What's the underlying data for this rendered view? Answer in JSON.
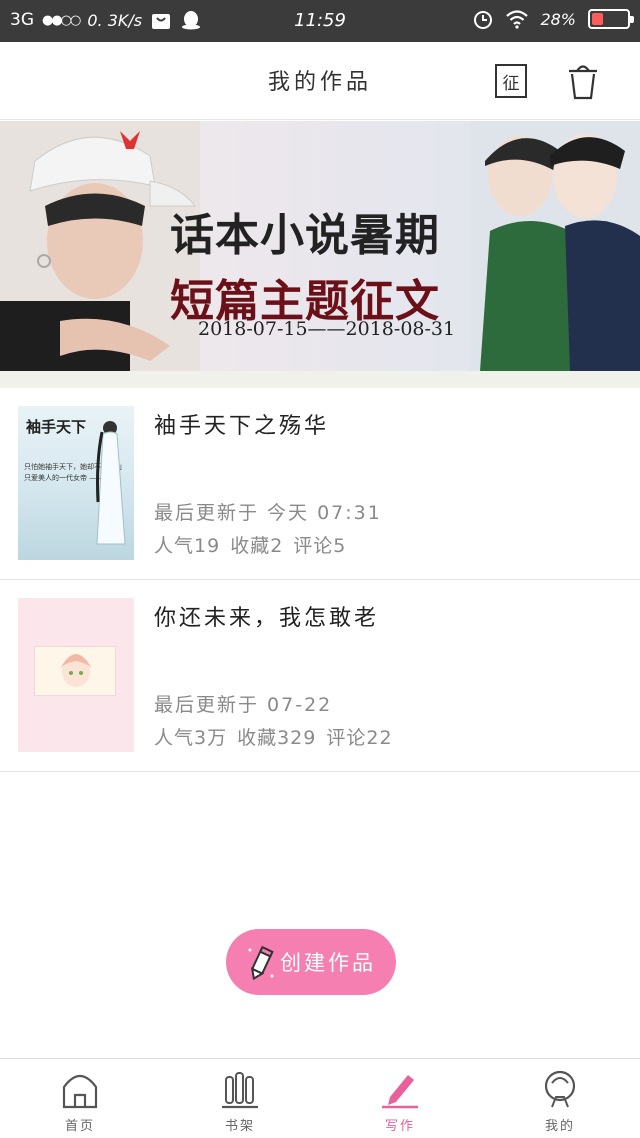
{
  "status_bar": {
    "network": "3G",
    "signal_dots": "●●○○",
    "speed": "0. 3K/s",
    "time": "11:59",
    "battery": "28%",
    "battery_level": 0.28
  },
  "header": {
    "title": "我的作品",
    "zheng_label": "征"
  },
  "banner": {
    "line1": "话本小说暑期",
    "line2": "短篇主题征文",
    "dates": "2018-07-15——2018-08-31"
  },
  "works": [
    {
      "title": "袖手天下之殇华",
      "updated": "最后更新于 今天 07:31",
      "popularity": "人气19",
      "favorites": "收藏2",
      "comments": "评论5",
      "cover_title": "袖手天下",
      "cover_text": "只怕她袖手天下，她却不爱江山只爱美人的一代女帝 ——殇华"
    },
    {
      "title": "你还未来，我怎敢老",
      "updated": "最后更新于 07-22",
      "popularity": "人气3万",
      "favorites": "收藏329",
      "comments": "评论22"
    }
  ],
  "create_button": "创建作品",
  "bottom_nav": {
    "items": [
      {
        "label": "首页",
        "icon": "home-icon"
      },
      {
        "label": "书架",
        "icon": "bookshelf-icon"
      },
      {
        "label": "写作",
        "icon": "pen-icon",
        "active": true
      },
      {
        "label": "我的",
        "icon": "profile-icon"
      }
    ]
  },
  "colors": {
    "accent": "#f57fb0",
    "active_nav": "#e9609b",
    "status_bar": "#3b3b3b"
  }
}
